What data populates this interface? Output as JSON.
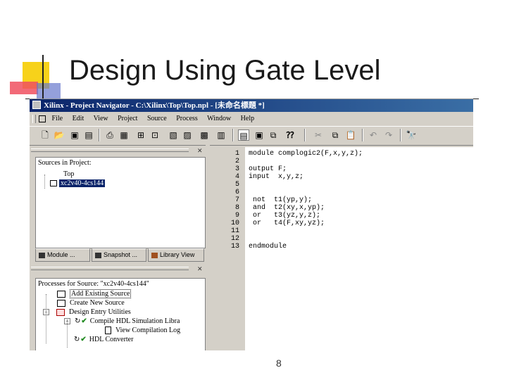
{
  "slide": {
    "title": "Design Using Gate Level",
    "page_number": "8"
  },
  "window": {
    "title": "Xilinx - Project Navigator - C:\\Xilinx\\Top\\Top.npl - [未命名標題 *]",
    "menu": [
      "File",
      "Edit",
      "View",
      "Project",
      "Source",
      "Process",
      "Window",
      "Help"
    ],
    "toolbar_icons": [
      "new-file-icon",
      "open-folder-icon",
      "save-icon",
      "save-all-icon",
      "print-icon",
      "print-preview-icon",
      "project-icon",
      "source-icon",
      "process-icon",
      "window-icon",
      "cascade-icon",
      "tile-icon",
      "help-icon",
      "cut-icon",
      "copy-icon",
      "paste-icon",
      "undo-icon",
      "redo-icon",
      "find-icon"
    ]
  },
  "sources": {
    "header": "Sources in Project:",
    "items": [
      {
        "label": "Top"
      },
      {
        "label": "xc2v40-4cs144"
      }
    ],
    "tabs": [
      "Module ...",
      "Snapshot ...",
      "Library View"
    ]
  },
  "processes": {
    "header": "Processes for Source: \"xc2v40-4cs144\"",
    "items": [
      {
        "label": "Add Existing Source"
      },
      {
        "label": "Create New Source"
      },
      {
        "label": "Design Entry Utilities"
      },
      {
        "label": "Compile HDL Simulation Libra"
      },
      {
        "label": "View Compilation Log"
      },
      {
        "label": "HDL Converter"
      }
    ]
  },
  "editor": {
    "line_numbers": [
      "1",
      "2",
      "3",
      "4",
      "5",
      "6",
      "7",
      "8",
      "9",
      "10",
      "11",
      "12",
      "13"
    ],
    "lines": [
      "module complogic2(F,x,y,z);",
      "",
      "output F;",
      "input  x,y,z;",
      "",
      "",
      " not  t1(yp,y);",
      " and  t2(xy,x,yp);",
      " or   t3(yz,y,z);",
      " or   t4(F,xy,yz);",
      "",
      "",
      "endmodule"
    ]
  },
  "colors": {
    "title_bar": "#0a246a",
    "deco_yellow": "#f5d000",
    "deco_red": "#e03030",
    "check_green": "#228b22"
  }
}
